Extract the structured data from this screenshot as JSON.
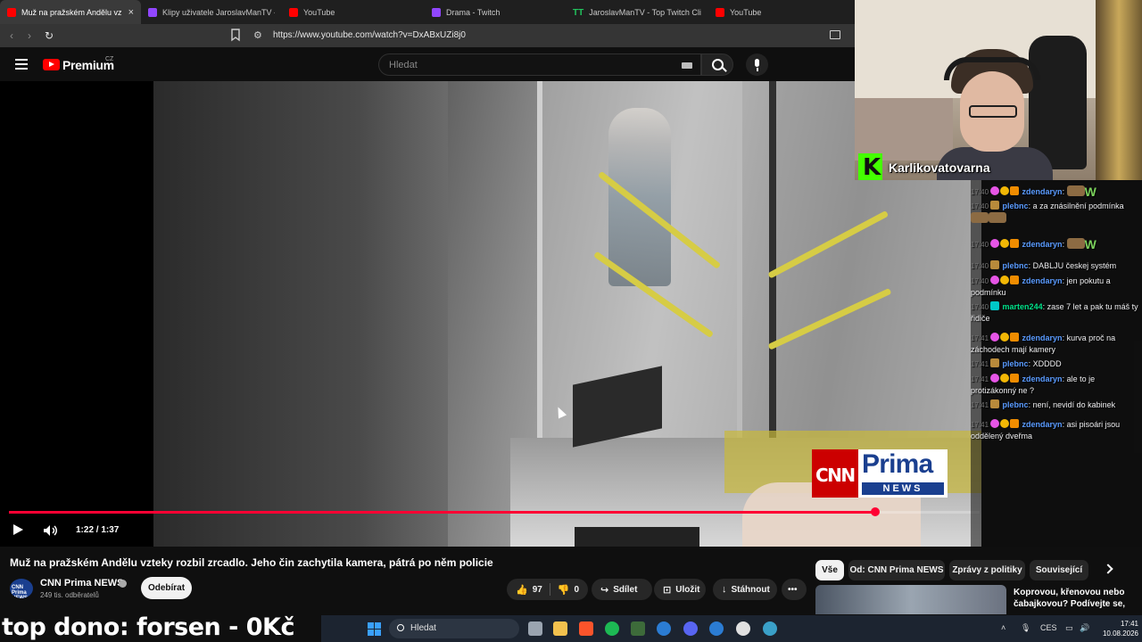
{
  "browser": {
    "tabs": [
      {
        "label": "Muž na pražském Andělu vztek",
        "favicon": "yt",
        "active": true
      },
      {
        "label": "Klipy uživatele JaroslavManTV - Twit",
        "favicon": "tw",
        "active": false
      },
      {
        "label": "YouTube",
        "favicon": "yt",
        "active": false
      },
      {
        "label": "Drama - Twitch",
        "favicon": "tw",
        "active": false
      },
      {
        "label": "JaroslavManTV - Top Twitch Clips -",
        "favicon": "tt",
        "active": false
      },
      {
        "label": "YouTube",
        "favicon": "yt",
        "active": false
      }
    ],
    "tab_close": "×",
    "url": "https://www.youtube.com/watch?v=DxABxUZi8j0"
  },
  "youtube": {
    "brand": "Premium",
    "region": "CZ",
    "search_placeholder": "Hledat",
    "overlay_logo": {
      "left": "CNN",
      "right": "Prima",
      "sub": "NEWS"
    },
    "player": {
      "time": "1:22 / 1:37",
      "progress": 0.8925
    },
    "video": {
      "title": "Muž na pražském Andělu vzteky rozbil zrcadlo. Jeho čin zachytila kamera, pátrá po něm policie",
      "channel": "CNN Prima NEWS",
      "channel_logo": "CNN Prima NEWS",
      "subscribers": "249 tis. odběratelů",
      "subscribe_label": "Odebírat",
      "likes": "97",
      "dislikes": "0",
      "share_label": "Sdílet",
      "save_label": "Uložit",
      "download_label": "Stáhnout"
    },
    "chips": [
      "Vše",
      "Od: CNN Prima NEWS",
      "Zprávy z politiky",
      "Související"
    ],
    "recommendation_title": "Koprovou, křenovou nebo čabajkovou? Podívejte se,"
  },
  "stream": {
    "streamer": "Karlikovatovarna",
    "dono_text": "top dono: forsen - 0Kč",
    "chat": [
      {
        "time": "17:40",
        "user": "zdendaryn",
        "text": "",
        "emote": "W"
      },
      {
        "time": "17:40",
        "user": "plebnc",
        "text": "a za znásilnění podmínka",
        "emote": ""
      },
      {
        "time": "17:40",
        "user": "zdendaryn",
        "text": "",
        "emote": "W"
      },
      {
        "time": "17:40",
        "user": "plebnc",
        "text": "DABLJU českej systém",
        "emote": ""
      },
      {
        "time": "17:40",
        "user": "zdendaryn",
        "text": "jen pokutu a podmínku",
        "emote": ""
      },
      {
        "time": "17:40",
        "user": "marten244",
        "text": "zase 7 let a pak tu máš ty řidiče",
        "emote": ""
      },
      {
        "time": "17:41",
        "user": "zdendaryn",
        "text": "kurva proč na záchodech mají kamery",
        "emote": ""
      },
      {
        "time": "17:41",
        "user": "plebnc",
        "text": "XDDDD",
        "emote": ""
      },
      {
        "time": "17:41",
        "user": "zdendaryn",
        "text": "ale to je protizákonný ne ?",
        "emote": ""
      },
      {
        "time": "17:41",
        "user": "plebnc",
        "text": "není, nevidí do kabinek",
        "emote": ""
      },
      {
        "time": "17:41",
        "user": "zdendaryn",
        "text": "asi pisoári jsou oddělený dveřma",
        "emote": ""
      }
    ]
  },
  "taskbar": {
    "search_placeholder": "Hledat",
    "language": "CES",
    "time": "17:41",
    "date": "10.08.2026"
  }
}
